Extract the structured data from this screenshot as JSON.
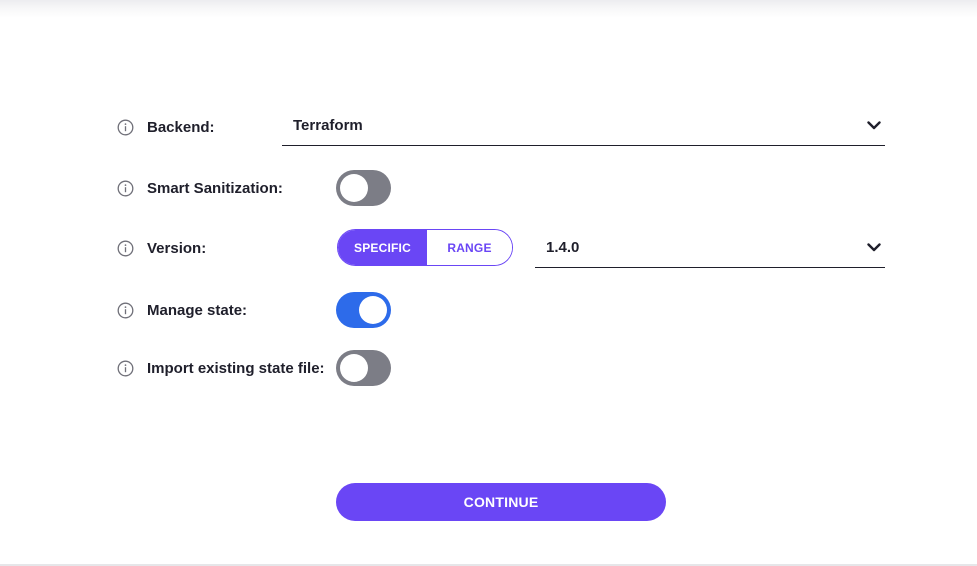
{
  "colors": {
    "accent": "#6a46f5",
    "toggle_on": "#2d6bea",
    "toggle_off": "#7c7d86",
    "text": "#1f1f2b"
  },
  "form": {
    "backend": {
      "icon": "info-icon",
      "label": "Backend:",
      "value": "Terraform",
      "dropdown_icon": "chevron-down-icon"
    },
    "smart_sanitization": {
      "icon": "info-icon",
      "label": "Smart Sanitization:",
      "enabled": false
    },
    "version": {
      "icon": "info-icon",
      "label": "Version:",
      "mode_options": [
        "SPECIFIC",
        "RANGE"
      ],
      "mode_selected": "SPECIFIC",
      "value": "1.4.0",
      "dropdown_icon": "chevron-down-icon"
    },
    "manage_state": {
      "icon": "info-icon",
      "label": "Manage state:",
      "enabled": true
    },
    "import_state": {
      "icon": "info-icon",
      "label": "Import existing state file:",
      "enabled": false
    }
  },
  "actions": {
    "continue_label": "CONTINUE"
  }
}
